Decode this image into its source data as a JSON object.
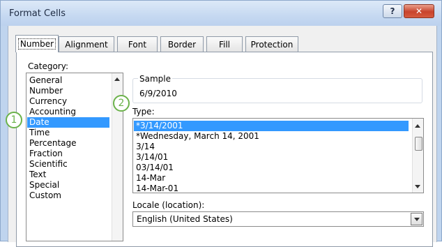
{
  "window": {
    "title": "Format Cells",
    "help_label": "?",
    "close_label": "✕"
  },
  "tabs": [
    "Number",
    "Alignment",
    "Font",
    "Border",
    "Fill",
    "Protection"
  ],
  "category": {
    "label": "Category:",
    "items": [
      "General",
      "Number",
      "Currency",
      "Accounting",
      "Date",
      "Time",
      "Percentage",
      "Fraction",
      "Scientific",
      "Text",
      "Special",
      "Custom"
    ],
    "selected": "Date"
  },
  "sample": {
    "label": "Sample",
    "value": "6/9/2010"
  },
  "type": {
    "label": "Type:",
    "items": [
      "*3/14/2001",
      "*Wednesday, March 14, 2001",
      "3/14",
      "3/14/01",
      "03/14/01",
      "14-Mar",
      "14-Mar-01"
    ],
    "selected": "*3/14/2001"
  },
  "locale": {
    "label": "Locale (location):",
    "value": "English (United States)"
  },
  "callouts": [
    "1",
    "2"
  ],
  "colors": {
    "selection": "#3399ff",
    "callout": "#6bb24a"
  },
  "icons": {
    "help": "question-icon",
    "close": "close-icon",
    "dropdown": "chevron-down-icon"
  }
}
